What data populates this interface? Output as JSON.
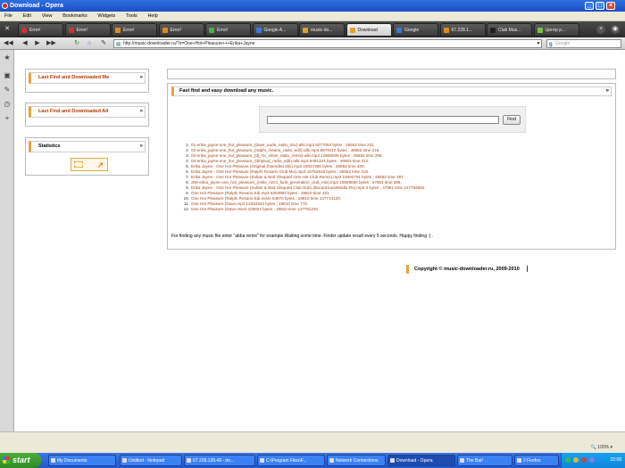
{
  "window": {
    "title": "Download - Opera"
  },
  "menu": [
    "File",
    "Edit",
    "View",
    "Bookmarks",
    "Widgets",
    "Tools",
    "Help"
  ],
  "tabs": [
    {
      "label": "Error!",
      "fav": "#c33"
    },
    {
      "label": "Error!",
      "fav": "#c33"
    },
    {
      "label": "Error!",
      "fav": "#e08a1e"
    },
    {
      "label": "Error!",
      "fav": "#e08a1e"
    },
    {
      "label": "Error!",
      "fav": "#4caf50"
    },
    {
      "label": "Google A...",
      "fav": "#3b7ae0"
    },
    {
      "label": "music-do...",
      "fav": "#e0a030"
    },
    {
      "label": "Download",
      "fav": "#e0a030",
      "active": true
    },
    {
      "label": "Google",
      "fav": "#3b7ae0"
    },
    {
      "label": "67.228.1...",
      "fav": "#e08a1e"
    },
    {
      "label": "Club Mus...",
      "fav": "#222"
    },
    {
      "label": "Центр р...",
      "fav": "#7ac143"
    }
  ],
  "address": {
    "url": "http://music-downloader.ru/?s=One+Hot+Pleasure+++Erika+Jayne",
    "search_placeholder": "Google"
  },
  "sidebar": {
    "last_find_me": "Last Find and Downloaded Me",
    "last_find_all": "Last Find and Downloaded All",
    "statistics": "Statistics",
    "arrow": "»"
  },
  "main": {
    "header": "Fast find and easy download any music.",
    "arrow": "»",
    "find_button": "Find",
    "query_value": "",
    "results": [
      {
        "n": "1.",
        "name": "01-erika_jayne-one_hot_pleasure_(dave_aude_radio_mix)-alki.mp3",
        "meta": "9277053 bytes ; 46552 time 231."
      },
      {
        "n": "2.",
        "name": "02-erika_jayne-one_hot_pleasure_(ralphi_rosario_radio_edit)-alki.mp3",
        "meta": "8679410 bytes ; 46552 time 216."
      },
      {
        "n": "3.",
        "name": "03-erika_jayne-one_hot_pleasure_(dj_mr_white_radio_remix)-alki.mp3",
        "meta": "10669939 bytes ; 46552 time 266."
      },
      {
        "n": "4.",
        "name": "04-erika_jayne-one_hot_pleasure_(dirtykud_radio_edit)-alki.mp3",
        "meta": "8491324 bytes ; 46552 time 212."
      },
      {
        "n": "5.",
        "name": "Erika Jayne - One Hot Pleasure (Original Extended Mix).mp3",
        "meta": "16037365 bytes ; 46552 time 400."
      },
      {
        "n": "6.",
        "name": "Erika Jayne - One Hot Pleasure (Ralphi Rosario Club Mix).mp3",
        "meta": "16752918 bytes ; 46552 time 418."
      },
      {
        "n": "7.",
        "name": "Erika Jayne - One Hot Pleasure (Sultan & Ned Shepard One Hot Club Remix).mp3",
        "meta": "19492791 bytes ; 46552 time 487."
      },
      {
        "n": "8.",
        "name": "208-erika_jayne-one_hot_pleasure_(mike_rizzo_funk_generation_club_mix).mp3",
        "meta": "10808650 bytes ; 47981 time 386."
      },
      {
        "n": "9.",
        "name": "Erika Jayne - One Hot Pleasure (Sultan & Ned Shepard Club Dub) (BacauHouseMafia.Ro).mp3",
        "meta": "0 bytes ; 47981 time 147792552."
      },
      {
        "n": "9.",
        "name": "One Hot Pleasure (Ralphi Rosario Edi.mp3",
        "meta": "5303993 bytes ; 19810 time 331."
      },
      {
        "n": "10.",
        "name": "One Hot Pleasure (Ralphi Rosario Edi.mism",
        "meta": "54870 bytes ; 19810 time 147714120."
      },
      {
        "n": "11.",
        "name": "One Hot Pleasure (Dave.mp3",
        "meta": "12322923 bytes ; 19810 time 770."
      },
      {
        "n": "12.",
        "name": "One Hot Pleasure (Dave.mism",
        "meta": "105822 bytes ; 19810 time 147791240."
      }
    ],
    "note": "For finding any music file enter \"abba remix\" for example.Waiting some time. Finder update result every 5 seconds. Happy finding :) ."
  },
  "footer": {
    "copyright": "Copyright © music-downloader.ru, 2009-2010"
  },
  "status": {
    "zoom": "100%"
  },
  "taskbar": {
    "start": "start",
    "items": [
      {
        "label": "My Documents"
      },
      {
        "label": "Untitled - Notepad"
      },
      {
        "label": "67.228.139.49 - de..."
      },
      {
        "label": "C:\\Program Files\\F..."
      },
      {
        "label": "Network Connections"
      },
      {
        "label": "Download - Opera",
        "active": true
      },
      {
        "label": "The Bat!"
      },
      {
        "label": "2 Firefox"
      }
    ],
    "clock": "22:08"
  }
}
